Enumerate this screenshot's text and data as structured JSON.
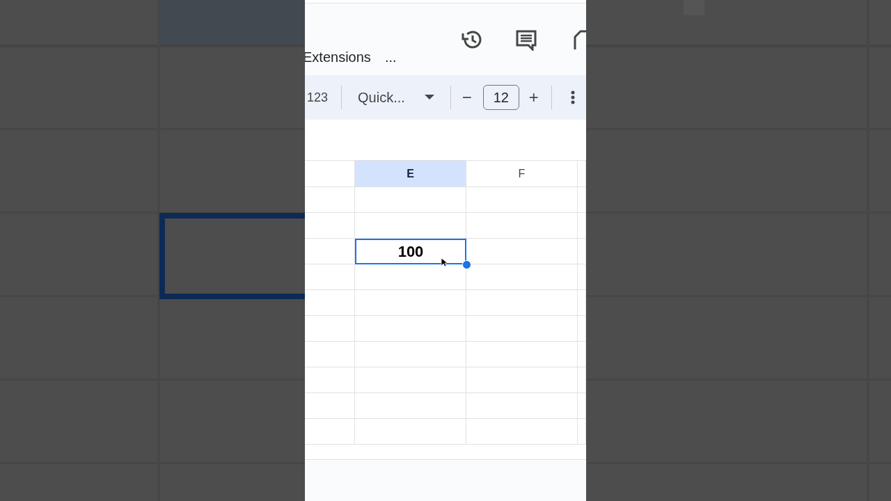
{
  "menu": {
    "items": [
      {
        "label": "Extensions"
      },
      {
        "label": "..."
      }
    ]
  },
  "header_icons": [
    {
      "kind": "history"
    },
    {
      "kind": "comment"
    },
    {
      "kind": "partial"
    }
  ],
  "toolbar": {
    "format": "123",
    "font": "Quick...",
    "font_size": "12",
    "decrease": "−",
    "increase": "+"
  },
  "sheet": {
    "columns": [
      {
        "selected": false
      },
      {
        "label": "E",
        "selected": true
      },
      {
        "label": "F",
        "selected": false
      },
      {
        "selected": false
      }
    ],
    "rows": [
      {
        "cells": [
          {
            "selected": false
          },
          {
            "selected": false
          },
          {
            "selected": false
          },
          {
            "selected": false
          }
        ]
      },
      {
        "cells": [
          {
            "selected": false
          },
          {
            "selected": false
          },
          {
            "selected": false
          },
          {
            "selected": false
          }
        ]
      },
      {
        "cells": [
          {
            "selected": false
          },
          {
            "text": "100",
            "selected": true
          },
          {
            "selected": false
          },
          {
            "selected": false
          }
        ]
      },
      {
        "cells": [
          {
            "selected": false
          },
          {
            "selected": false
          },
          {
            "selected": false
          },
          {
            "selected": false
          }
        ]
      },
      {
        "cells": [
          {
            "selected": false
          },
          {
            "selected": false
          },
          {
            "selected": false
          },
          {
            "selected": false
          }
        ]
      },
      {
        "cells": [
          {
            "selected": false
          },
          {
            "selected": false
          },
          {
            "selected": false
          },
          {
            "selected": false
          }
        ]
      },
      {
        "cells": [
          {
            "selected": false
          },
          {
            "selected": false
          },
          {
            "selected": false
          },
          {
            "selected": false
          }
        ]
      },
      {
        "cells": [
          {
            "selected": false
          },
          {
            "selected": false
          },
          {
            "selected": false
          },
          {
            "selected": false
          }
        ]
      },
      {
        "cells": [
          {
            "selected": false
          },
          {
            "selected": false
          },
          {
            "selected": false
          },
          {
            "selected": false
          }
        ]
      },
      {
        "cells": [
          {
            "selected": false
          },
          {
            "selected": false
          },
          {
            "selected": false
          },
          {
            "selected": false
          }
        ]
      }
    ]
  }
}
